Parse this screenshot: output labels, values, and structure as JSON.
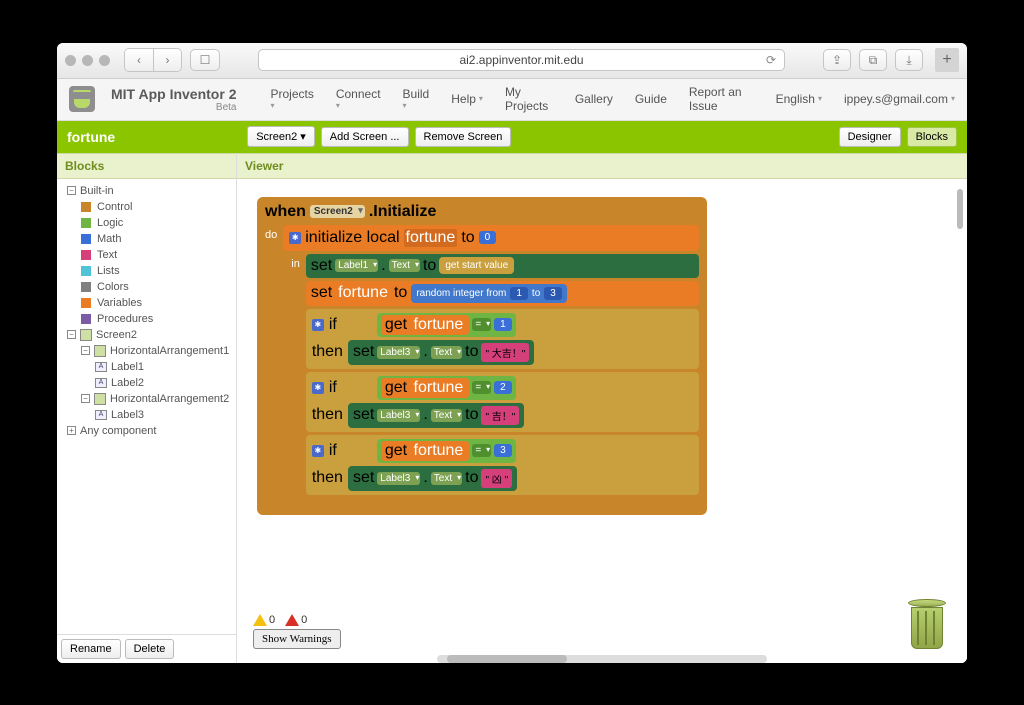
{
  "browser": {
    "url": "ai2.appinventor.mit.edu"
  },
  "header": {
    "title": "MIT App Inventor 2",
    "beta": "Beta",
    "menus": [
      {
        "label": "Projects",
        "caret": true
      },
      {
        "label": "Connect",
        "caret": true
      },
      {
        "label": "Build",
        "caret": true
      },
      {
        "label": "Help",
        "caret": true,
        "inline": true
      },
      {
        "label": "My Projects",
        "caret": false
      },
      {
        "label": "Gallery",
        "caret": false
      },
      {
        "label": "Guide",
        "caret": false
      },
      {
        "label": "Report an Issue",
        "caret": false
      },
      {
        "label": "English",
        "caret": true
      },
      {
        "label": "ippey.s@gmail.com",
        "caret": true
      }
    ]
  },
  "greenbar": {
    "project": "fortune",
    "screen_selector": "Screen2",
    "add_screen": "Add Screen ...",
    "remove_screen": "Remove Screen",
    "designer": "Designer",
    "blocks": "Blocks"
  },
  "sidebar": {
    "title": "Blocks",
    "builtin": "Built-in",
    "categories": [
      {
        "label": "Control",
        "color": "#c88529"
      },
      {
        "label": "Logic",
        "color": "#6eb544"
      },
      {
        "label": "Math",
        "color": "#3a6fd8"
      },
      {
        "label": "Text",
        "color": "#d6407a"
      },
      {
        "label": "Lists",
        "color": "#4fc4d6"
      },
      {
        "label": "Colors",
        "color": "#808080"
      },
      {
        "label": "Variables",
        "color": "#e97c24"
      },
      {
        "label": "Procedures",
        "color": "#7b5ba6"
      }
    ],
    "components": {
      "screen": "Screen2",
      "ha1": "HorizontalArrangement1",
      "label1": "Label1",
      "label2": "Label2",
      "ha2": "HorizontalArrangement2",
      "label3": "Label3",
      "any": "Any component"
    },
    "rename": "Rename",
    "delete": "Delete"
  },
  "viewer": {
    "title": "Viewer",
    "warnings_count": "0",
    "errors_count": "0",
    "show_warnings": "Show Warnings"
  },
  "blocks": {
    "when": "when",
    "screen2": "Screen2",
    "initialize": ".Initialize",
    "do": "do",
    "init_local": "initialize local",
    "fortune": "fortune",
    "to": "to",
    "zero": "0",
    "in": "in",
    "set": "set",
    "label1": "Label1",
    "label3": "Label3",
    "dot": ".",
    "text": "Text",
    "get_start": "get start value",
    "random": "random integer from",
    "one": "1",
    "three": "3",
    "two": "2",
    "if": "if",
    "then": "then",
    "get": "get",
    "eq": "=",
    "daikichi": "\" 大吉！\"",
    "kichi": "\" 吉！\"",
    "kyou": "\" 凶 \""
  }
}
